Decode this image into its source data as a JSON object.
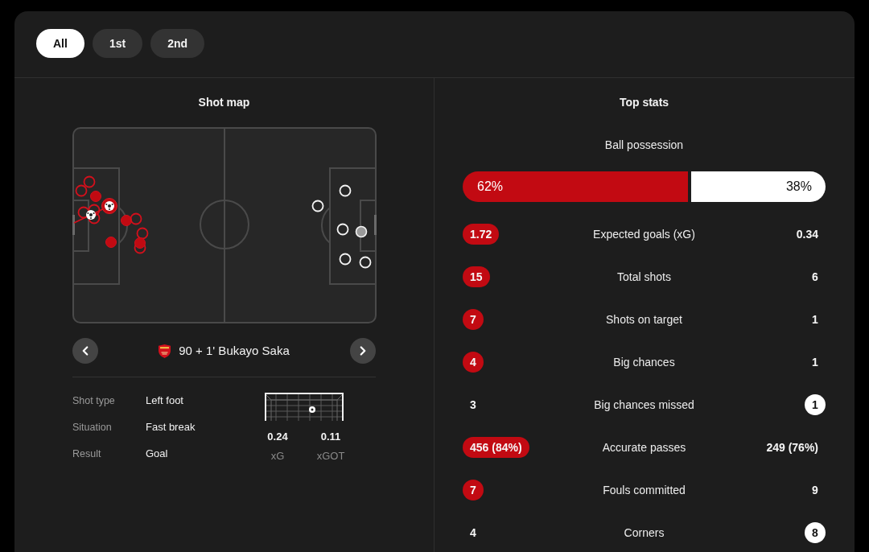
{
  "period_tabs": [
    {
      "label": "All",
      "selected": true
    },
    {
      "label": "1st",
      "selected": false
    },
    {
      "label": "2nd",
      "selected": false
    }
  ],
  "shot_map": {
    "title": "Shot map",
    "selected_shot": {
      "caption": "90 + 1' Bukayo Saka",
      "details": [
        {
          "label": "Shot type",
          "value": "Left foot"
        },
        {
          "label": "Situation",
          "value": "Fast break"
        },
        {
          "label": "Result",
          "value": "Goal"
        }
      ],
      "goal_stats": [
        {
          "value": "0.24",
          "label": "xG"
        },
        {
          "value": "0.11",
          "label": "xGOT"
        }
      ]
    }
  },
  "top_stats": {
    "title": "Top stats",
    "possession": {
      "label": "Ball possession",
      "home": "62%",
      "away": "38%",
      "level": 0.62
    },
    "rows": [
      {
        "label": "Expected goals (xG)",
        "home": {
          "value": "1.72",
          "highlighted": true
        },
        "away": {
          "value": "0.34",
          "highlighted": false
        }
      },
      {
        "label": "Total shots",
        "home": {
          "value": "15",
          "highlighted": true
        },
        "away": {
          "value": "6",
          "highlighted": false
        }
      },
      {
        "label": "Shots on target",
        "home": {
          "value": "7",
          "highlighted": true
        },
        "away": {
          "value": "1",
          "highlighted": false
        }
      },
      {
        "label": "Big chances",
        "home": {
          "value": "4",
          "highlighted": true
        },
        "away": {
          "value": "1",
          "highlighted": false
        }
      },
      {
        "label": "Big chances missed",
        "home": {
          "value": "3",
          "highlighted": false
        },
        "away": {
          "value": "1",
          "highlighted": true
        }
      },
      {
        "label": "Accurate passes",
        "home": {
          "value": "456 (84%)",
          "highlighted": true
        },
        "away": {
          "value": "249 (76%)",
          "highlighted": false
        }
      },
      {
        "label": "Fouls committed",
        "home": {
          "value": "7",
          "highlighted": true
        },
        "away": {
          "value": "9",
          "highlighted": false
        }
      },
      {
        "label": "Corners",
        "home": {
          "value": "4",
          "highlighted": false
        },
        "away": {
          "value": "8",
          "highlighted": true
        }
      }
    ]
  }
}
